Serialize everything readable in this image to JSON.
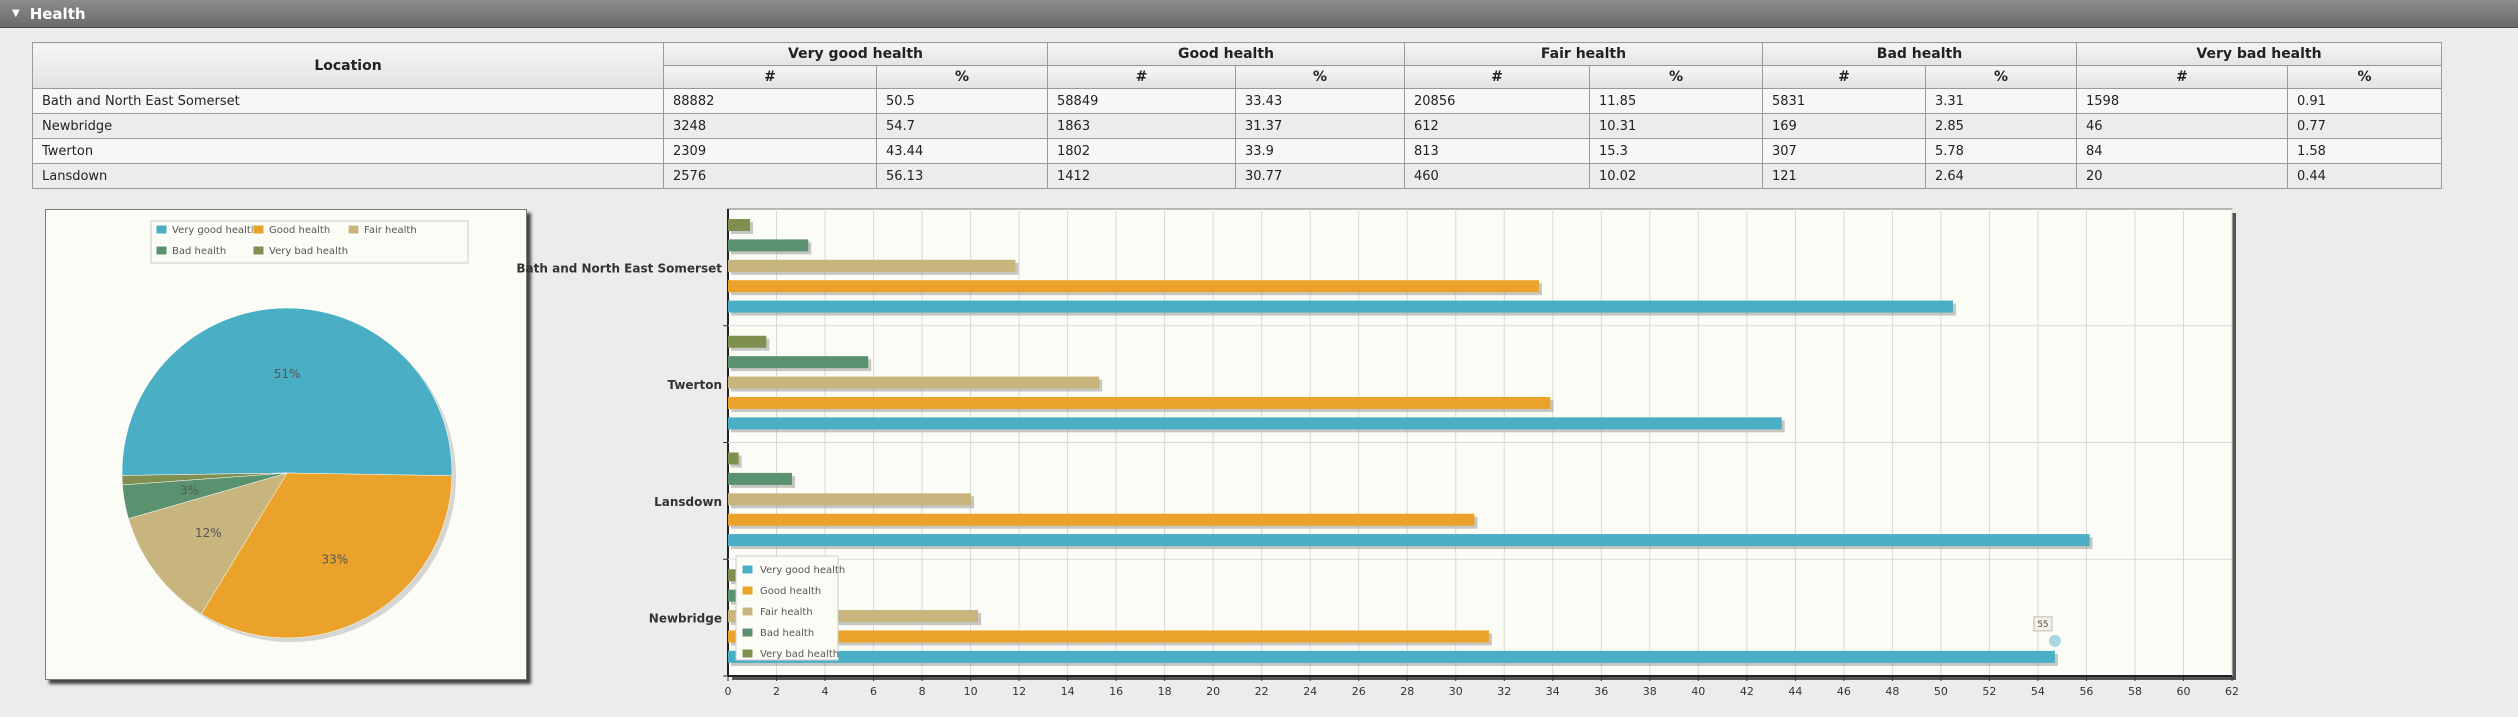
{
  "section": {
    "title": "Health"
  },
  "table": {
    "location_header": "Location",
    "groups": [
      "Very good health",
      "Good health",
      "Fair health",
      "Bad health",
      "Very bad health"
    ],
    "sub_headers": [
      "#",
      "%"
    ],
    "rows": [
      {
        "location": "Bath and North East Somerset",
        "cells": [
          "88882",
          "50.5",
          "58849",
          "33.43",
          "20856",
          "11.85",
          "5831",
          "3.31",
          "1598",
          "0.91"
        ]
      },
      {
        "location": "Newbridge",
        "cells": [
          "3248",
          "54.7",
          "1863",
          "31.37",
          "612",
          "10.31",
          "169",
          "2.85",
          "46",
          "0.77"
        ]
      },
      {
        "location": "Twerton",
        "cells": [
          "2309",
          "43.44",
          "1802",
          "33.9",
          "813",
          "15.3",
          "307",
          "5.78",
          "84",
          "1.58"
        ]
      },
      {
        "location": "Lansdown",
        "cells": [
          "2576",
          "56.13",
          "1412",
          "30.77",
          "460",
          "10.02",
          "121",
          "2.64",
          "20",
          "0.44"
        ]
      }
    ]
  },
  "colors": {
    "Very good health": "#4aafc4",
    "Good health": "#eba22a",
    "Fair health": "#c8b57e",
    "Bad health": "#5a9270",
    "Very bad health": "#7f8f4f"
  },
  "chart_data": [
    {
      "type": "pie",
      "legend": [
        "Very good health",
        "Good health",
        "Fair health",
        "Bad health",
        "Very bad health"
      ],
      "slices": [
        {
          "name": "Very good health",
          "value": 50.5,
          "label": "51%"
        },
        {
          "name": "Good health",
          "value": 33.43,
          "label": "33%"
        },
        {
          "name": "Fair health",
          "value": 11.85,
          "label": "12%"
        },
        {
          "name": "Bad health",
          "value": 3.31,
          "label": "3%"
        },
        {
          "name": "Very bad health",
          "value": 0.91,
          "label": ""
        }
      ],
      "legend_position": "top"
    },
    {
      "type": "bar",
      "orientation": "horizontal",
      "categories": [
        "Bath and North East Somerset",
        "Twerton",
        "Lansdown",
        "Newbridge"
      ],
      "series": [
        {
          "name": "Very good health",
          "values": [
            50.5,
            43.44,
            56.13,
            54.7
          ]
        },
        {
          "name": "Good health",
          "values": [
            33.43,
            33.9,
            30.77,
            31.37
          ]
        },
        {
          "name": "Fair health",
          "values": [
            11.85,
            15.3,
            10.02,
            10.31
          ]
        },
        {
          "name": "Bad health",
          "values": [
            3.31,
            5.78,
            2.64,
            2.85
          ]
        },
        {
          "name": "Very bad health",
          "values": [
            0.91,
            1.58,
            0.44,
            0.77
          ]
        }
      ],
      "xlim": [
        0,
        62
      ],
      "xticks": [
        0,
        2,
        4,
        6,
        8,
        10,
        12,
        14,
        16,
        18,
        20,
        22,
        24,
        26,
        28,
        30,
        32,
        34,
        36,
        38,
        40,
        42,
        44,
        46,
        48,
        50,
        52,
        54,
        56,
        58,
        60,
        62
      ],
      "grid": true,
      "legend_position": "bottom-left",
      "tooltip": {
        "label": "55",
        "category": "Newbridge",
        "value": 54.7
      }
    }
  ]
}
